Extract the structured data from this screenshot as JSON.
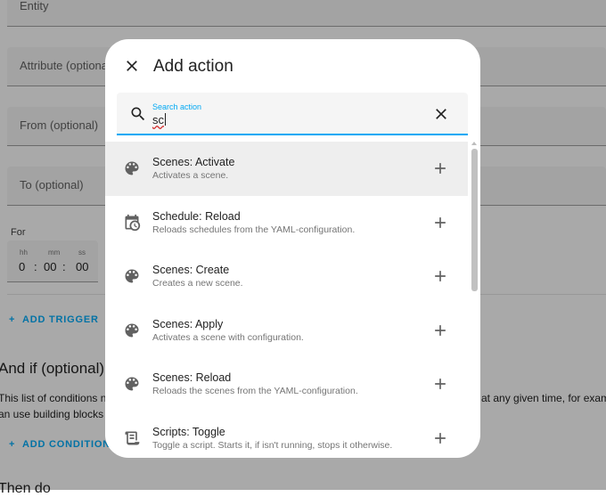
{
  "background": {
    "fields": {
      "entity": "Entity",
      "attribute": "Attribute (optional",
      "from": "From (optional)",
      "to": "To (optional)"
    },
    "for_label": "For",
    "duration": {
      "hh_label": "hh",
      "mm_label": "mm",
      "ss_label": "ss",
      "hh": "0",
      "mm": "00",
      "ss": "00",
      "sep": ":"
    },
    "add_trigger": "ADD TRIGGER",
    "and_if_heading": "And if (optional)",
    "conditions_text_left": "This list of conditions n",
    "conditions_text_right": "at any given time, for exam",
    "building_blocks_text": "an use building blocks",
    "add_condition": "ADD CONDITION",
    "then_heading": "Then do"
  },
  "dialog": {
    "title": "Add action",
    "search": {
      "label": "Search action",
      "value": "sc"
    },
    "items": [
      {
        "title": "Scenes: Activate",
        "description": "Activates a scene.",
        "icon": "palette-icon"
      },
      {
        "title": "Schedule: Reload",
        "description": "Reloads schedules from the YAML-configuration.",
        "icon": "calendar-clock-icon"
      },
      {
        "title": "Scenes: Create",
        "description": "Creates a new scene.",
        "icon": "palette-icon"
      },
      {
        "title": "Scenes: Apply",
        "description": "Activates a scene with configuration.",
        "icon": "palette-icon"
      },
      {
        "title": "Scenes: Reload",
        "description": "Reloads the scenes from the YAML-configuration.",
        "icon": "palette-icon"
      },
      {
        "title": "Scripts: Toggle",
        "description": "Toggle a script. Starts it, if isn't running, stops it otherwise.",
        "icon": "script-icon"
      }
    ]
  },
  "colors": {
    "accent": "#03a9f4",
    "scrim": "rgba(0,0,0,0.32)",
    "selected_row": "#eeeeee"
  }
}
